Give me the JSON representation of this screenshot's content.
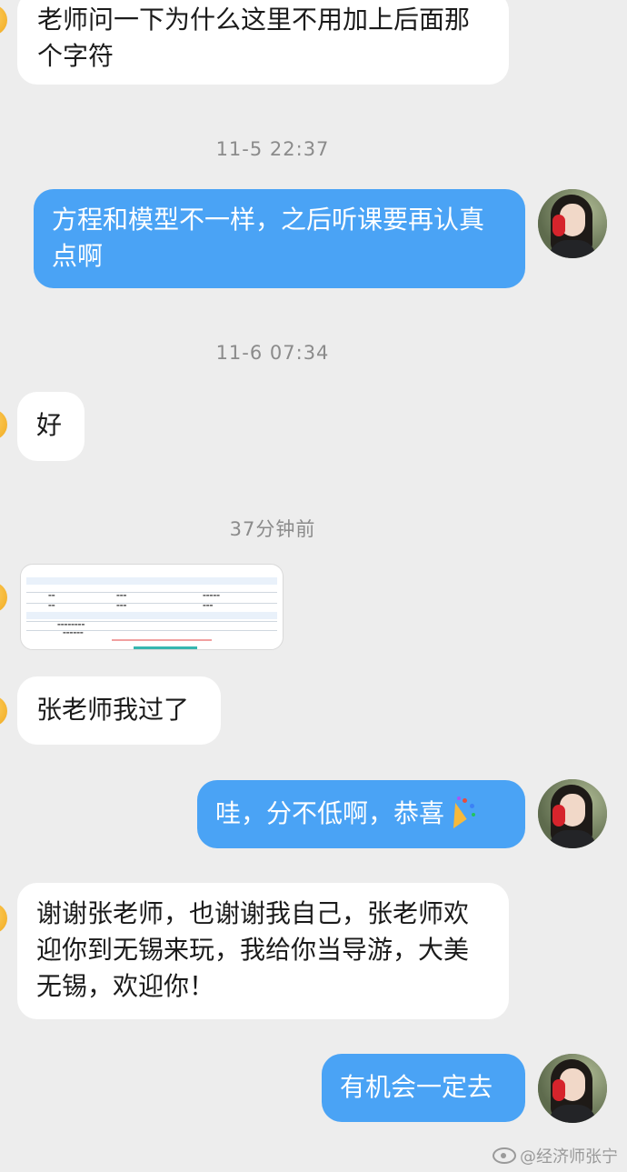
{
  "messages": {
    "m1": "老师问一下为什么这里不用加上后面那个字符",
    "t1": "11-5 22:37",
    "m2": "方程和模型不一样，之后听课要再认真点啊",
    "t2": "11-6 07:34",
    "m3": "好",
    "t3": "37分钟前",
    "m5": "张老师我过了",
    "m6": "哇，分不低啊，恭喜",
    "m7": "谢谢张老师，也谢谢我自己，张老师欢迎你到无锡来玩，我给你当导游，大美无锡，欢迎你！",
    "m8": "有机会一定去"
  },
  "watermark": "@经济师张宁",
  "icons": {
    "incoming_avatar": "avatar-icon",
    "outgoing_avatar": "teacher-avatar-icon",
    "emoji": "party-popper-icon",
    "weibo": "weibo-logo-icon"
  },
  "colors": {
    "background": "#ededed",
    "incoming_bubble": "#ffffff",
    "outgoing_bubble": "#4aa3f5",
    "timestamp": "#8b8b8b"
  }
}
